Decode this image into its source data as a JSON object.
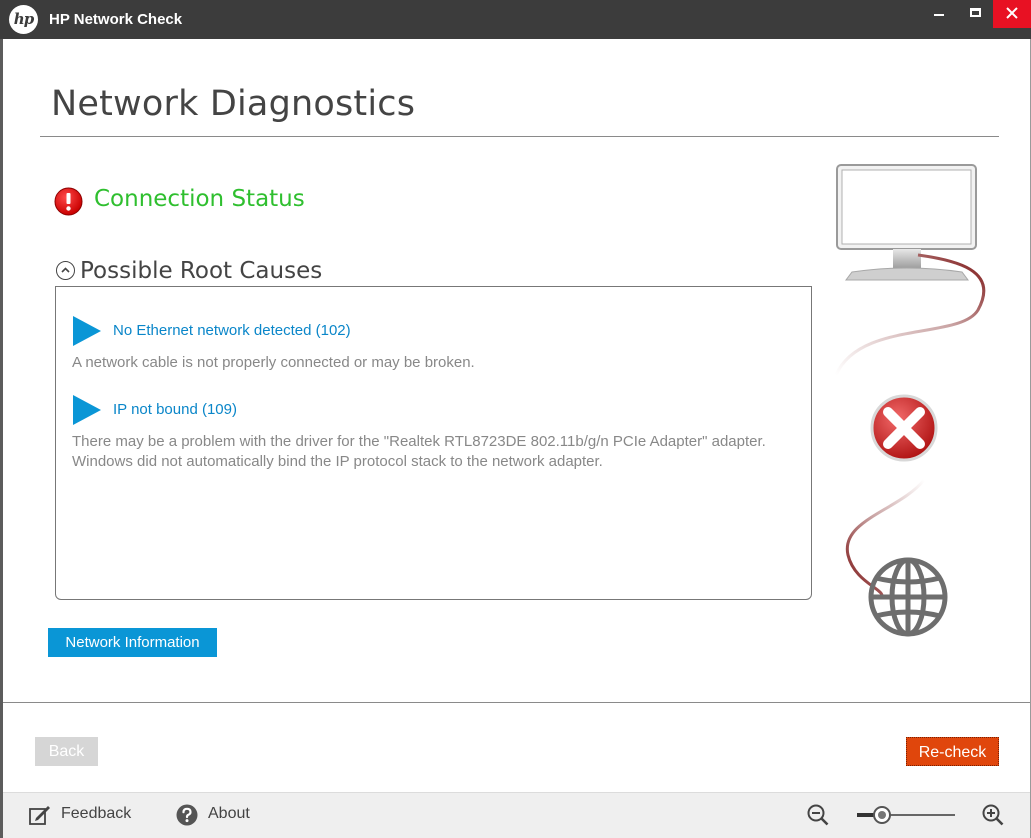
{
  "window": {
    "title": "HP Network Check",
    "logo_text": "hp"
  },
  "page": {
    "title": "Network Diagnostics"
  },
  "status": {
    "label": "Connection Status",
    "color": "#2fbf2f"
  },
  "causes": {
    "title": "Possible Root Causes",
    "items": [
      {
        "title": "No Ethernet network detected (102)",
        "description_lines": [
          "A network cable is not properly connected or may be broken."
        ]
      },
      {
        "title": "IP not bound (109)",
        "description_lines": [
          "There may be a problem with the driver for the \"Realtek RTL8723DE 802.11b/g/n PCIe Adapter\" adapter.",
          "Windows did not automatically bind the IP protocol stack to the network adapter."
        ]
      }
    ]
  },
  "buttons": {
    "network_info": "Network Information",
    "back": "Back",
    "recheck": "Re-check"
  },
  "footer": {
    "feedback": "Feedback",
    "about": "About",
    "zoom_level": 0.25
  },
  "colors": {
    "accent_blue": "#0a96d6",
    "link_blue": "#0a86c9",
    "recheck_orange": "#e0460c",
    "error_red": "#e81123"
  },
  "icons": {
    "status": "error-exclamation-icon",
    "computer": "monitor-icon",
    "failure": "red-x-icon",
    "internet": "globe-icon"
  }
}
